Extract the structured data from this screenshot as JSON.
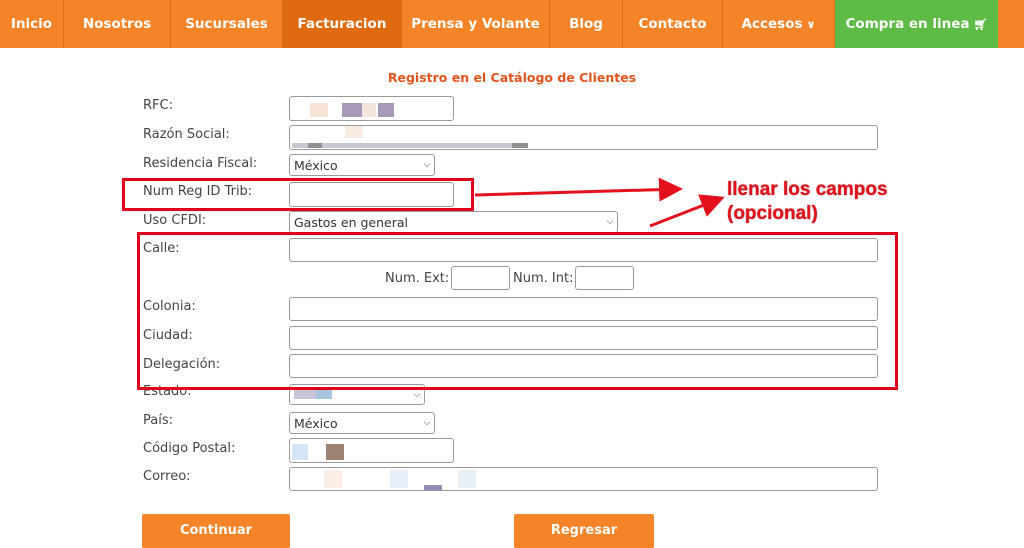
{
  "nav": {
    "items": [
      {
        "label": "Inicio"
      },
      {
        "label": "Nosotros"
      },
      {
        "label": "Sucursales"
      },
      {
        "label": "Facturacion"
      },
      {
        "label": "Prensa y Volante"
      },
      {
        "label": "Blog"
      },
      {
        "label": "Contacto"
      },
      {
        "label": "Accesos"
      },
      {
        "label": "Compra en linea"
      }
    ],
    "active": "Facturacion",
    "colors": {
      "bar": "#f58327",
      "active": "#e06a10",
      "buy": "#5dbb46"
    }
  },
  "form": {
    "title": "Registro en el Catálogo de Clientes",
    "labels": {
      "rfc": "RFC:",
      "razon_social": "Razón Social:",
      "residencia_fiscal": "Residencia Fiscal:",
      "num_reg": "Num Reg ID Trib:",
      "uso_cfdi": "Uso CFDI:",
      "calle": "Calle:",
      "num_ext": "Num. Ext:",
      "num_int": "Num. Int:",
      "colonia": "Colonia:",
      "ciudad": "Ciudad:",
      "delegacion": "Delegación:",
      "estado": "Estado:",
      "pais": "País:",
      "codigo_postal": "Código Postal:",
      "correo": "Correo:"
    },
    "values": {
      "residencia_fiscal": "México",
      "uso_cfdi": "Gastos en general",
      "pais": "México"
    }
  },
  "annotation": {
    "line1": "llenar los campos",
    "line2": "(opcional)",
    "color": "#e4101b"
  },
  "buttons": {
    "continuar": "Continuar",
    "regresar": "Regresar"
  }
}
